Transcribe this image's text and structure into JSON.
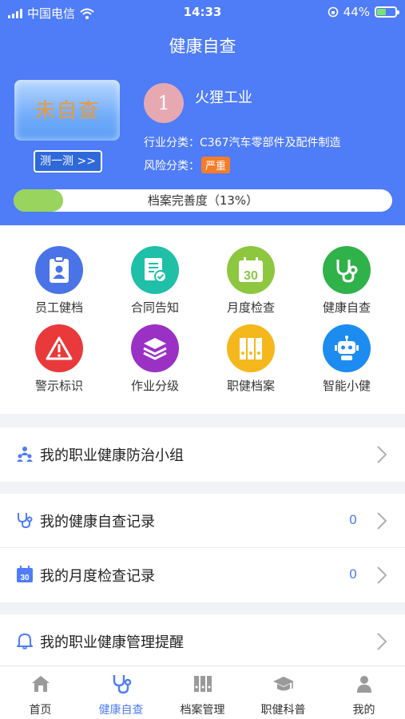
{
  "status_bar": {
    "carrier": "中国电信",
    "time": "14:33",
    "battery": "44%"
  },
  "header": {
    "title": "健康自查"
  },
  "self_check": {
    "status": "未自查",
    "test_button": "测一测 >>"
  },
  "company": {
    "avatar_letter": "1",
    "name": "火狸工业",
    "industry_label": "行业分类：",
    "industry_value": "C367汽车零部件及配件制造",
    "risk_label": "风险分类：",
    "risk_value": "严重"
  },
  "profile_completeness": {
    "label": "档案完善度（13%）",
    "percent": 13
  },
  "grid": [
    {
      "label": "员工健档",
      "icon": "employee-file-icon",
      "color": "#4a73e8"
    },
    {
      "label": "合同告知",
      "icon": "contract-icon",
      "color": "#1fbfa8"
    },
    {
      "label": "月度检查",
      "icon": "calendar-30-icon",
      "color": "#8dc63f"
    },
    {
      "label": "健康自查",
      "icon": "stethoscope-icon",
      "color": "#2fb24a"
    },
    {
      "label": "警示标识",
      "icon": "warning-icon",
      "color": "#e9393b"
    },
    {
      "label": "作业分级",
      "icon": "layers-icon",
      "color": "#9b31c4"
    },
    {
      "label": "职健档案",
      "icon": "binders-icon",
      "color": "#f5b81c"
    },
    {
      "label": "智能小健",
      "icon": "robot-icon",
      "color": "#1d8cf0"
    }
  ],
  "list": {
    "group": {
      "label": "我的职业健康防治小组",
      "icon": "team-icon"
    },
    "self_check_records": {
      "label": "我的健康自查记录",
      "count": "0",
      "icon": "stethoscope-icon"
    },
    "monthly_records": {
      "label": "我的月度检查记录",
      "count": "0",
      "icon": "calendar-30-icon"
    },
    "reminders": {
      "label": "我的职业健康管理提醒",
      "icon": "bell-icon"
    }
  },
  "tabbar": [
    {
      "label": "首页",
      "icon": "home-icon"
    },
    {
      "label": "健康自查",
      "icon": "stethoscope-icon",
      "active": true
    },
    {
      "label": "档案管理",
      "icon": "binders-icon"
    },
    {
      "label": "职健科普",
      "icon": "graduation-cap-icon"
    },
    {
      "label": "我的",
      "icon": "person-icon"
    }
  ],
  "colors": {
    "primary": "#4f7cf7",
    "progress": "#98d45e",
    "risk": "#f57c2b"
  }
}
